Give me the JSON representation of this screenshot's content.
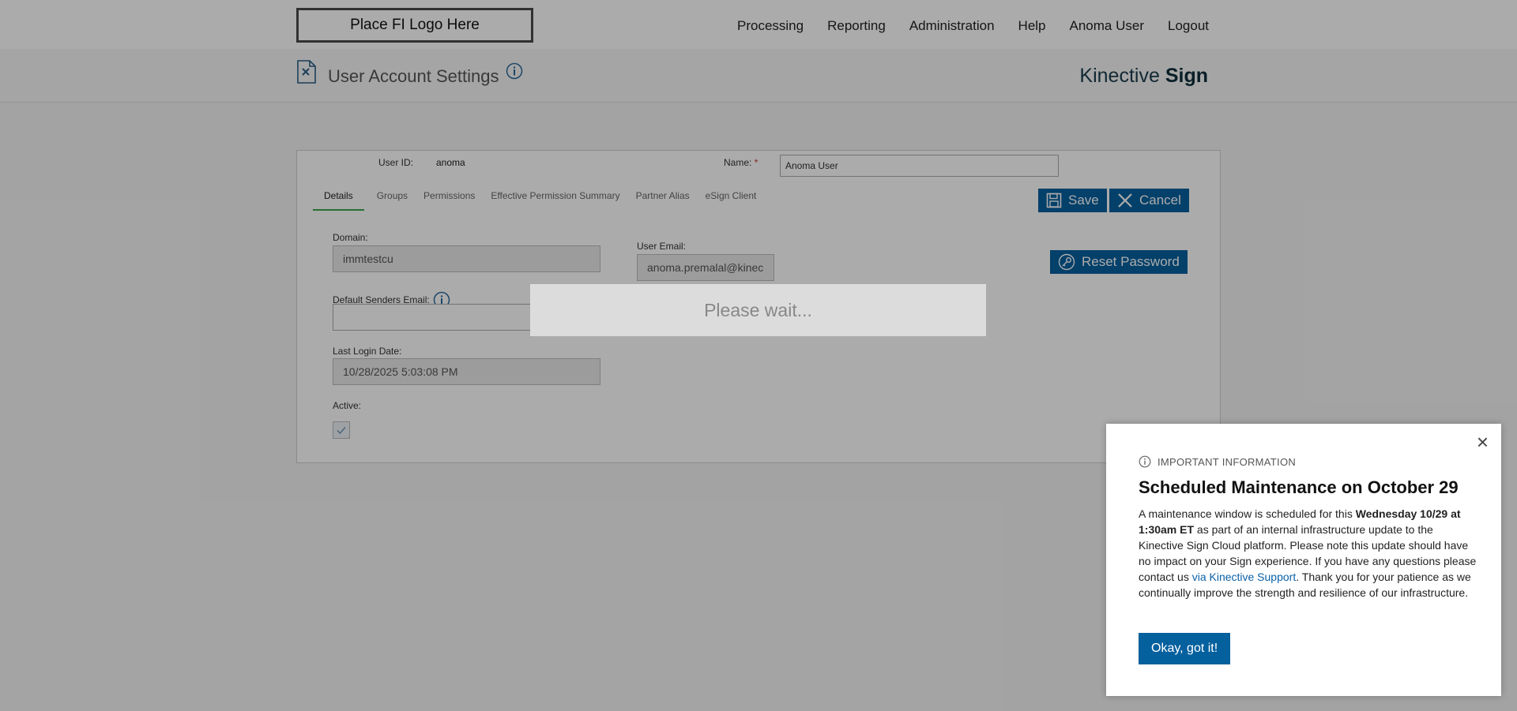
{
  "header": {
    "logo_text": "Place FI Logo Here",
    "nav": [
      "Processing",
      "Reporting",
      "Administration",
      "Help",
      "Anoma User",
      "Logout"
    ]
  },
  "subheader": {
    "title": "User Account Settings",
    "brand_regular": "Kinective",
    "brand_bold": "Sign"
  },
  "form": {
    "user_id_label": "User ID:",
    "user_id_value": "anoma",
    "name_label": "Name:",
    "name_required": "*",
    "name_value": "Anoma User",
    "tabs": [
      "Details",
      "Groups",
      "Permissions",
      "Effective Permission Summary",
      "Partner Alias",
      "eSign Client"
    ],
    "save_label": "Save",
    "cancel_label": "Cancel",
    "domain_label": "Domain:",
    "domain_value": "immtestcu",
    "user_email_label": "User Email:",
    "user_email_value": "anoma.premalal@kinec",
    "reset_password_label": "Reset Password",
    "default_senders_email_label": "Default Senders Email:",
    "default_senders_email_value": "",
    "last_login_label": "Last Login Date:",
    "last_login_value": "10/28/2025 5:03:08 PM",
    "active_label": "Active:",
    "active_checked": true
  },
  "loading": {
    "text": "Please wait..."
  },
  "modal": {
    "kicker": "IMPORTANT INFORMATION",
    "title": "Scheduled Maintenance on October 29",
    "body_1": "A maintenance window is scheduled for this ",
    "body_bold": "Wednesday 10/29 at 1:30am ET",
    "body_2": " as part of an internal infrastructure update to the Kinective Sign Cloud platform. Please note this update should have no impact on your Sign experience. If you have any questions please contact us ",
    "body_link": "via Kinective Support",
    "body_3": ". Thank you for your patience as we continually improve the strength and resilience of our infrastructure.",
    "ok_label": "Okay, got it!",
    "close_glyph": "×"
  },
  "colors": {
    "primary_button": "#05609e",
    "active_tab_underline": "#3fa34d",
    "link": "#0a61a8"
  }
}
